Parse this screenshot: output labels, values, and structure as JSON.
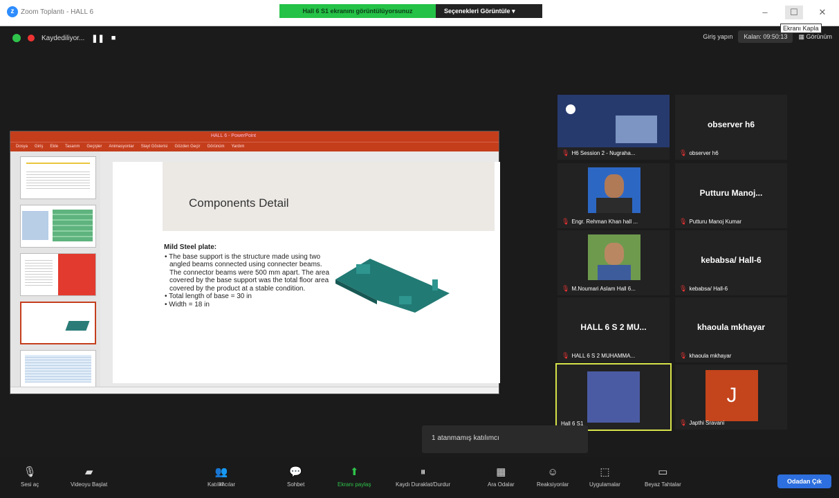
{
  "window": {
    "title": "Zoom Toplantı - HALL 6",
    "tooltip": "Ekranı Kapla"
  },
  "banner": {
    "sharing": "Hall 6 S1 ekranını görüntülüyorsunuz",
    "view_options": "Seçenekleri Görüntüle"
  },
  "status": {
    "recording": "Kaydediliyor...",
    "login": "Giriş yapın",
    "timer": "Kalan: 09:50:13",
    "view": "Görünüm"
  },
  "ppt": {
    "title": "HALL 6 - PowerPoint",
    "tabs": [
      "Dosya",
      "Giriş",
      "Ekle",
      "Tasarım",
      "Geçişler",
      "Animasyonlar",
      "Slayt Gösterisi",
      "Gözden Geçir",
      "Görünüm",
      "Yardım"
    ]
  },
  "slide": {
    "heading": "Components Detail",
    "subhead": "Mild Steel plate:",
    "bullets": [
      "The base support is the structure made using two angled beams connected using connecter beams. The connector beams were 500 mm apart. The area covered by the base support was the total floor area covered by the product at a stable condition.",
      "Total length of base = 30 in",
      "Width = 18 in"
    ]
  },
  "participants": [
    {
      "name": "H6 Session 2 - Nugraha...",
      "big": ""
    },
    {
      "name": "observer h6",
      "big": "observer h6"
    },
    {
      "name": "Engr. Rehman Khan hall ...",
      "big": ""
    },
    {
      "name": "Putturu Manoj Kumar",
      "big": "Putturu Manoj..."
    },
    {
      "name": "M.Noumari Aslam Hall 6...",
      "big": ""
    },
    {
      "name": "kebabsa/ Hall-6",
      "big": "kebabsa/ Hall-6"
    },
    {
      "name": "HALL 6 S 2 MUHAMMA...",
      "big": "HALL 6 S 2 MU..."
    },
    {
      "name": "khaoula mkhayar",
      "big": "khaoula mkhayar"
    },
    {
      "name": "Hall 6 S1",
      "big": ""
    },
    {
      "name": "Japthi Sravani",
      "big": "J"
    }
  ],
  "toast": "1 atanmamış katılımcı",
  "toolbar": {
    "audio": "Sesi aç",
    "video": "Videoyu Başlat",
    "participants": "Katılımcılar",
    "participants_count": "12",
    "chat": "Sohbet",
    "share": "Ekranı paylaş",
    "record": "Kaydı Duraklat/Durdur",
    "breakout": "Ara Odalar",
    "reactions": "Reaksiyonlar",
    "apps": "Uygulamalar",
    "whiteboard": "Beyaz Tahtalar",
    "leave": "Odadan Çık"
  },
  "colors": {
    "share_green": "#24c247",
    "ppt_red": "#c43e1c",
    "active_speaker": "#d8e34a",
    "leave_blue": "#2d6fde"
  }
}
